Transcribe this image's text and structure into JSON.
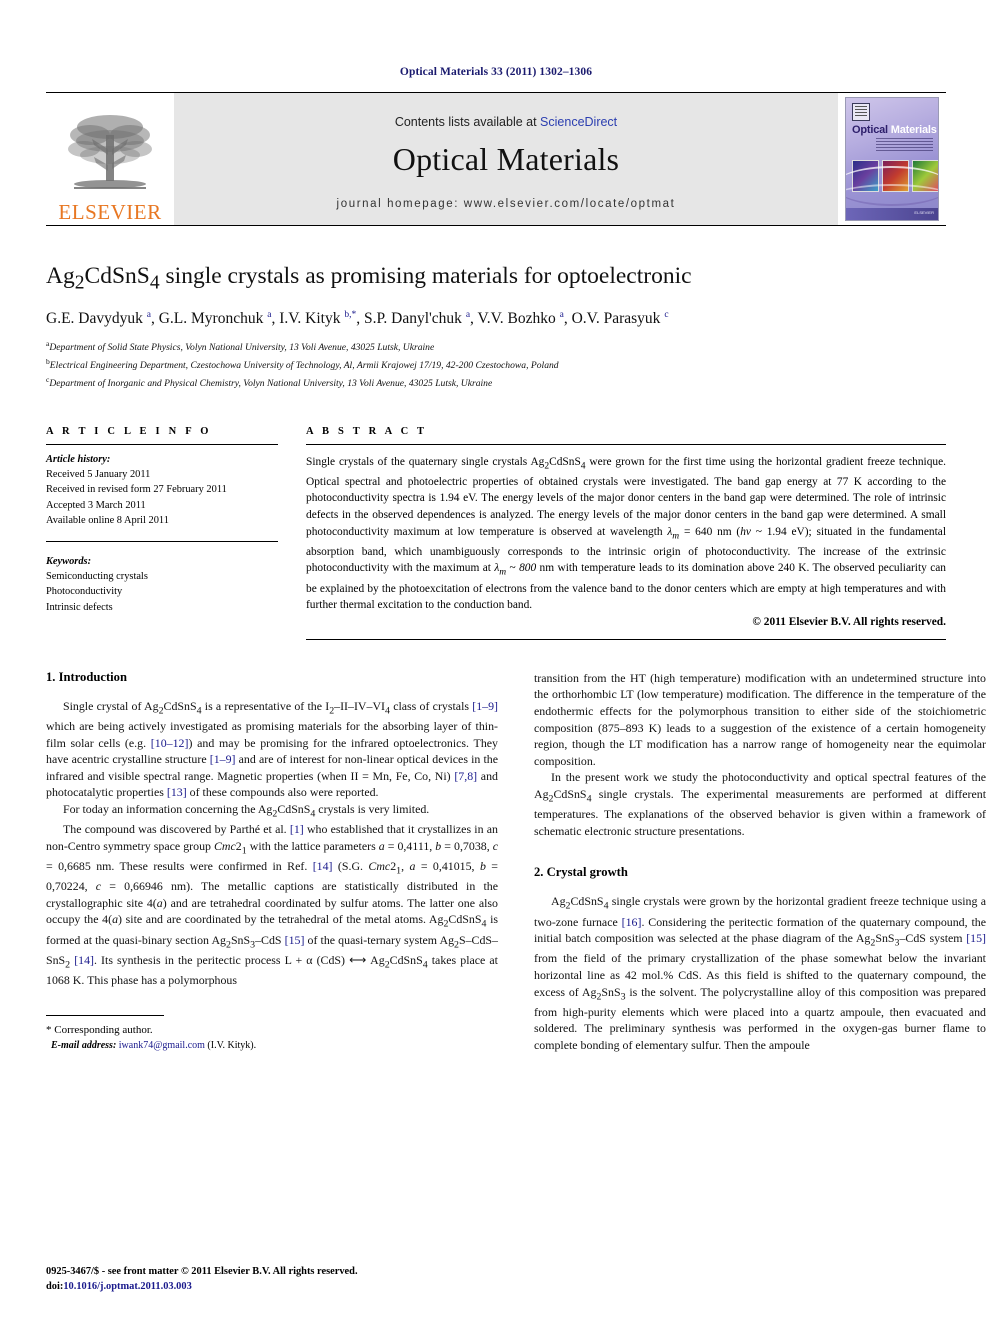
{
  "running_head": "Optical Materials 33 (2011) 1302–1306",
  "masthead": {
    "publisher_logo_text": "ELSEVIER",
    "contents_prefix": "Contents lists available at ",
    "contents_link": "ScienceDirect",
    "journal_name": "Optical Materials",
    "homepage_line": "journal homepage: www.elsevier.com/locate/optmat",
    "cover": {
      "title_first": "Optical ",
      "title_second": "Materials"
    }
  },
  "article": {
    "title_html": "Ag<sub>2</sub>CdSnS<sub>4</sub> single crystals as promising materials for optoelectronic",
    "authors_html": "G.E. Davydyuk <sup>a</sup>, G.L. Myronchuk <sup>a</sup>, I.V. Kityk <sup>b,</sup><sup>*</sup>, S.P. Danyl'chuk <sup>a</sup>, V.V. Bozhko <sup>a</sup>, O.V. Parasyuk <sup>c</sup>",
    "affiliations": [
      "Department of Solid State Physics, Volyn National University, 13 Voli Avenue, 43025 Lutsk, Ukraine",
      "Electrical Engineering Department, Czestochowa University of Technology, Al, Armii Krajowej 17/19, 42-200 Czestochowa, Poland",
      "Department of Inorganic and Physical Chemistry, Volyn National University, 13 Voli Avenue, 43025 Lutsk, Ukraine"
    ],
    "affiliation_marks": [
      "a",
      "b",
      "c"
    ]
  },
  "article_info": {
    "heading": "A R T I C L E    I N F O",
    "history_label": "Article history:",
    "history": [
      "Received 5 January 2011",
      "Received in revised form 27 February 2011",
      "Accepted 3 March 2011",
      "Available online 8 April 2011"
    ],
    "keywords_label": "Keywords:",
    "keywords": [
      "Semiconducting crystals",
      "Photoconductivity",
      "Intrinsic defects"
    ]
  },
  "abstract": {
    "heading": "A B S T R A C T",
    "text_html": "Single crystals of the quaternary single crystals Ag<sub>2</sub>CdSnS<sub>4</sub> were grown for the first time using the horizontal gradient freeze technique. Optical spectral and photoelectric properties of obtained crystals were investigated. The band gap energy at 77 K according to the photoconductivity spectra is 1.94 eV. The energy levels of the major donor centers in the band gap were determined. The role of intrinsic defects in the observed dependences is analyzed. The energy levels of the major donor centers in the band gap were determined. A small photoconductivity maximum at low temperature is observed at wavelength <i>&lambda;<sub>m</sub></i> = 640 nm (<i>hv</i> ~ 1.94 eV); situated in the fundamental absorption band, which unambiguously corresponds to the intrinsic origin of photoconductivity. The increase of the extrinsic photoconductivity with the maximum at <i>&lambda;<sub>m</sub></i> ~ <i>800</i> nm with temperature leads to its domination above 240 K. The observed peculiarity can be explained by the photoexcitation of electrons from the valence band to the donor centers which are empty at high temperatures and with further thermal excitation to the conduction band.",
    "copyright": "© 2011 Elsevier B.V. All rights reserved."
  },
  "sections": {
    "introduction_heading": "1. Introduction",
    "intro_p1_html": "Single crystal of Ag<sub>2</sub>CdSnS<sub>4</sub> is a representative of the I<sub>2</sub>–II–IV–VI<sub>4</sub> class of crystals <a class=\"ref\">[1–9]</a> which are being actively investigated as promising materials for the absorbing layer of thin-film solar cells (e.g. <a class=\"ref\">[10–12]</a>) and may be promising for the infrared optoelectronics. They have acentric crystalline structure <a class=\"ref\">[1–9]</a> and are of interest for non-linear optical devices in the infrared and visible spectral range. Magnetic properties (when II = Mn, Fe, Co, Ni) <a class=\"ref\">[7,8]</a> and photocatalytic properties <a class=\"ref\">[13]</a> of these compounds also were reported.",
    "intro_p2_html": "For today an information concerning the Ag<sub>2</sub>CdSnS<sub>4</sub> crystals is very limited.",
    "intro_p3_html": "The compound was discovered by Parthé et al. <a class=\"ref\">[1]</a> who established that it crystallizes in an non-Centro symmetry space group <i>Cmc</i>2<sub>1</sub> with the lattice parameters <i>a</i> = 0,4111, <i>b</i> = 0,7038, <i>c</i> = 0,6685 nm. These results were confirmed in Ref. <a class=\"ref\">[14]</a> (S.G. <i>Cmc</i>2<sub>1</sub>, <i>a</i> = 0,41015, <i>b</i> = 0,70224, <i>c</i> = 0,66946 nm). The metallic captions are statistically distributed in the crystallographic site 4(<i>a</i>) and are tetrahedral coordinated by sulfur atoms. The latter one also occupy the 4(<i>a</i>) site and are coordinated by the tetrahedral of the metal atoms. Ag<sub>2</sub>CdSnS<sub>4</sub> is formed at the quasi-binary section Ag<sub>2</sub>SnS<sub>3</sub>–CdS <a class=\"ref\">[15]</a> of the quasi-ternary system Ag<sub>2</sub>S–CdS–SnS<sub>2</sub> <a class=\"ref\">[14]</a>. Its synthesis in the peritectic process L + &alpha; (CdS) &#10231; Ag<sub>2</sub>CdSnS<sub>4</sub> takes place at 1068 K. This phase has a polymorphous",
    "right_p1_html": "transition from the HT (high temperature) modification with an undetermined structure into the orthorhombic LT (low temperature) modification. The difference in the temperature of the endothermic effects for the polymorphous transition to either side of the stoichiometric composition (875–893 K) leads to a suggestion of the existence of a certain homogeneity region, though the LT modification has a narrow range of homogeneity near the equimolar composition.",
    "right_p2_html": "In the present work we study the photoconductivity and optical spectral features of the Ag<sub>2</sub>CdSnS<sub>4</sub> single crystals. The experimental measurements are performed at different temperatures. The explanations of the observed behavior is given within a framework of schematic electronic structure presentations.",
    "crystal_growth_heading": "2. Crystal growth",
    "growth_p1_html": "Ag<sub>2</sub>CdSnS<sub>4</sub> single crystals were grown by the horizontal gradient freeze technique using a two-zone furnace <a class=\"ref\">[16]</a>. Considering the peritectic formation of the quaternary compound, the initial batch composition was selected at the phase diagram of the Ag<sub>2</sub>SnS<sub>3</sub>–CdS system <a class=\"ref\">[15]</a> from the field of the primary crystallization of the phase somewhat below the invariant horizontal line as 42 mol.% CdS. As this field is shifted to the quaternary compound, the excess of Ag<sub>2</sub>SnS<sub>3</sub> is the solvent. The polycrystalline alloy of this composition was prepared from high-purity elements which were placed into a quartz ampoule, then evacuated and soldered. The preliminary synthesis was performed in the oxygen-gas burner flame to complete bonding of elementary sulfur. Then the ampoule"
  },
  "footnote": {
    "corresponding": "* Corresponding author.",
    "email_label": "E-mail address:",
    "email": "iwank74@gmail.com",
    "email_suffix": " (I.V. Kityk)."
  },
  "page_footer": {
    "issn_line": "0925-3467/$ - see front matter © 2011 Elsevier B.V. All rights reserved.",
    "doi_label": "doi:",
    "doi_value": "10.1016/j.optmat.2011.03.003"
  }
}
